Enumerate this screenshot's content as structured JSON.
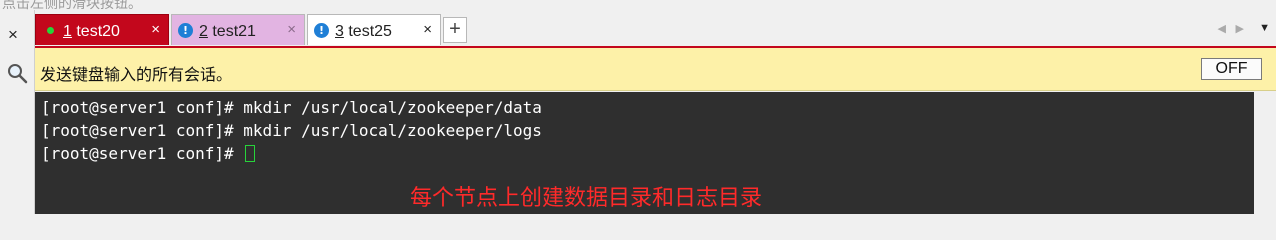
{
  "top_hint": "点击左侧的滑块按钮。",
  "tabs": [
    {
      "number": "1",
      "name": "test20",
      "close": "×",
      "status": "connected"
    },
    {
      "number": "2",
      "name": "test21",
      "close": "×",
      "status": "info"
    },
    {
      "number": "3",
      "name": "test25",
      "close": "×",
      "status": "info"
    }
  ],
  "add_tab": "+",
  "left_close": "×",
  "banner": {
    "text": "发送键盘输入的所有会话。",
    "toggle_label": "OFF"
  },
  "terminal": {
    "lines": [
      "[root@server1 conf]# mkdir /usr/local/zookeeper/data",
      "[root@server1 conf]# mkdir /usr/local/zookeeper/logs",
      "[root@server1 conf]# "
    ],
    "annotation": "每个节点上创建数据目录和日志目录"
  },
  "icons": {
    "info": "info-icon",
    "search": "search-icon",
    "connected": "green-dot-icon"
  },
  "colors": {
    "active_tab": "#c3071c",
    "tab2_bg": "#e2b4e2",
    "banner_bg": "#fdf1a8",
    "terminal_bg": "#2f2f2f",
    "annotation": "#ff2a2a",
    "cursor": "#27d33a"
  }
}
